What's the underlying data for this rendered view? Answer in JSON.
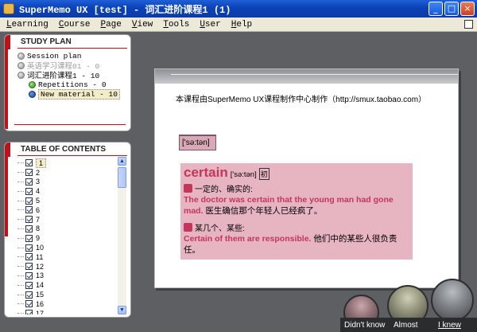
{
  "window": {
    "title": "SuperMemo UX [test] - 词汇进阶课程1 (1)",
    "buttons": {
      "minimize": "_",
      "maximize": "□",
      "close": "×"
    }
  },
  "menu": [
    "Learning",
    "Course",
    "Page",
    "View",
    "Tools",
    "User",
    "Help"
  ],
  "study_plan": {
    "header": "STUDY PLAN",
    "items": [
      {
        "label": "Session plan"
      },
      {
        "label": "英语学习课程01 - 0"
      },
      {
        "label": "词汇进阶课程1 - 10"
      },
      {
        "label": "Repetitions - 0"
      },
      {
        "label": "New material - 10"
      }
    ]
  },
  "toc": {
    "header": "TABLE OF CONTENTS",
    "items": [
      "1",
      "2",
      "3",
      "4",
      "5",
      "6",
      "7",
      "8",
      "9",
      "10",
      "11",
      "12",
      "13",
      "14",
      "15",
      "16",
      "17"
    ],
    "scroll_up": "▲",
    "scroll_down": "▼"
  },
  "card": {
    "intro": "本课程由SuperMemo UX课程制作中心制作（http://smux.taobao.com）",
    "phonetic": "['sə:tən]",
    "dict": {
      "headword": "certain",
      "phonetic": "['sə:tən]",
      "pos": "初",
      "sense1": "一定的、确实的:",
      "example1_en": "The doctor was certain that the young man had gone mad.",
      "example1_zh": "医生确信那个年轻人已经疯了。",
      "sense2": "某几个、某些:",
      "example2_en": "Certain of them are responsible.",
      "example2_zh": "他们中的某些人很负责任。"
    }
  },
  "grades": {
    "didnt_know": "Didn't know",
    "almost": "Almost",
    "i_knew": "I knew"
  }
}
